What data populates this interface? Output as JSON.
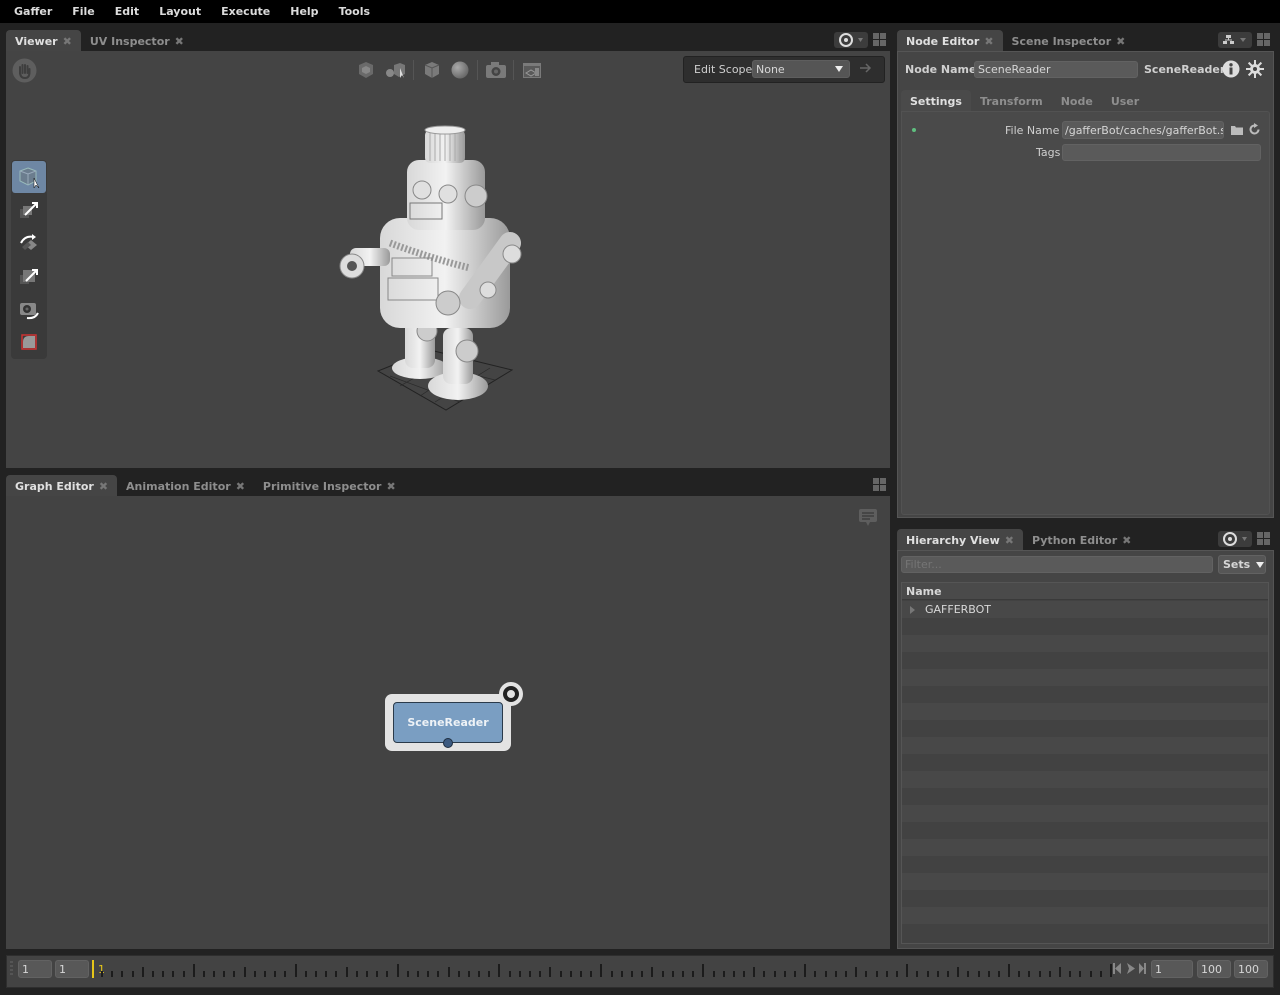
{
  "menubar": {
    "items": [
      "Gaffer",
      "File",
      "Edit",
      "Layout",
      "Execute",
      "Help",
      "Tools"
    ]
  },
  "viewer": {
    "tabs": [
      {
        "label": "Viewer",
        "active": true
      },
      {
        "label": "UV Inspector",
        "active": false
      }
    ],
    "toolbar_icons": [
      "selection-mask-icon",
      "shading-mode-icon",
      "wireframe-cube-icon",
      "sphere-icon",
      "camera-icon",
      "grid-icon"
    ],
    "edit_scope": {
      "label": "Edit Scope",
      "value": "None"
    },
    "tools": [
      {
        "name": "select-tool",
        "active": true
      },
      {
        "name": "translate-tool",
        "active": false
      },
      {
        "name": "rotate-tool",
        "active": false
      },
      {
        "name": "scale-tool",
        "active": false
      },
      {
        "name": "camera-tool",
        "active": false
      },
      {
        "name": "crop-window-tool",
        "active": false
      }
    ],
    "scene_object": "robot-model"
  },
  "graph_editor": {
    "tabs": [
      {
        "label": "Graph Editor",
        "active": true
      },
      {
        "label": "Animation Editor",
        "active": false
      },
      {
        "label": "Primitive Inspector",
        "active": false
      }
    ],
    "node": {
      "label": "SceneReader",
      "color": "#7a9ec2"
    }
  },
  "node_editor": {
    "tabs": [
      {
        "label": "Node Editor",
        "active": true
      },
      {
        "label": "Scene Inspector",
        "active": false
      }
    ],
    "node_name_label": "Node Name",
    "node_name_value": "SceneReader",
    "node_type": "SceneReader",
    "sections": [
      {
        "label": "Settings",
        "active": true
      },
      {
        "label": "Transform",
        "active": false
      },
      {
        "label": "Node",
        "active": false
      },
      {
        "label": "User",
        "active": false
      }
    ],
    "plugs": [
      {
        "label": "File Name",
        "value": "/gafferBot/caches/gafferBot.scc"
      },
      {
        "label": "Tags",
        "value": ""
      }
    ],
    "status_color": "#5fbf7f"
  },
  "hierarchy": {
    "tabs": [
      {
        "label": "Hierarchy View",
        "active": true
      },
      {
        "label": "Python Editor",
        "active": false
      }
    ],
    "filter_placeholder": "Filter...",
    "sets_label": "Sets",
    "column": "Name",
    "rows": [
      "GAFFERBOT"
    ]
  },
  "timeline": {
    "start_min": "1",
    "start": "1",
    "current_frame": "1",
    "frame": "1",
    "end": "100",
    "end_max": "100",
    "accent": "#e6c619"
  }
}
